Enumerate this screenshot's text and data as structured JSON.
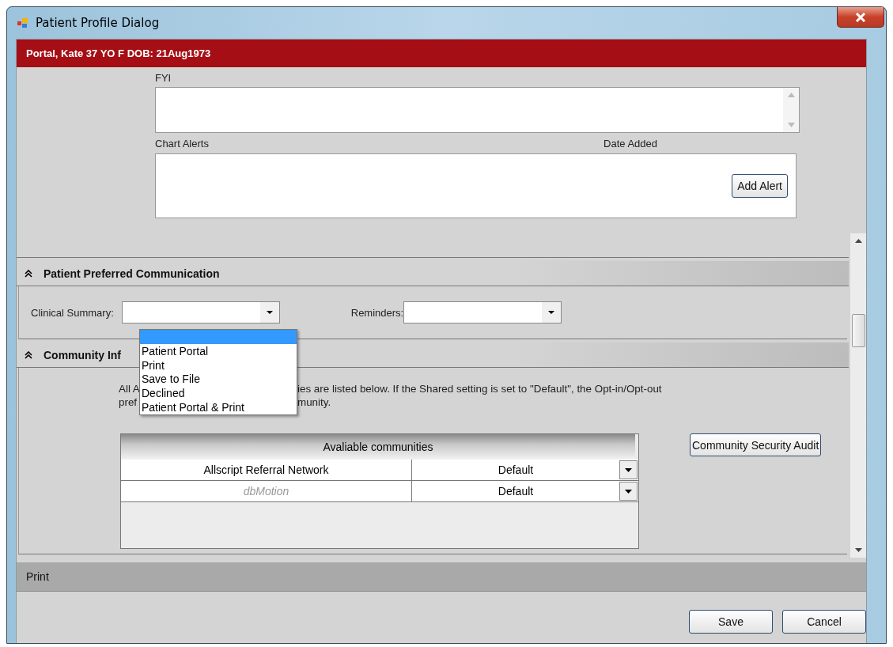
{
  "window": {
    "title": "Patient Profile Dialog"
  },
  "patient_banner": "Portal, Kate  37 YO  F DOB: 21Aug1973",
  "fyi": {
    "label": "FYI"
  },
  "chart_alerts": {
    "label": "Chart Alerts",
    "date_column": "Date Added",
    "add_button": "Add Alert"
  },
  "preferred_communication": {
    "title": "Patient Preferred Communication",
    "expanded": true,
    "clinical_summary": {
      "label": "Clinical Summary:",
      "open": true,
      "options": [
        {
          "selected": true
        },
        {
          "label": "Patient Portal",
          "selected": false
        },
        {
          "label": "Print",
          "selected": false
        },
        {
          "label": "Save to File",
          "selected": false
        },
        {
          "label": "Declined",
          "selected": false
        },
        {
          "label": "Patient Portal & Print",
          "selected": false
        }
      ]
    },
    "reminders": {
      "label": "Reminders:"
    }
  },
  "community": {
    "title": "Community Inf",
    "expanded": true,
    "note_line_1": [
      "All A",
      "ies are listed below. If the Shared setting is set to \"Default\", the Opt-in/Opt-out"
    ],
    "note_line_2": [
      "pref",
      "munity."
    ],
    "table": {
      "header": "Avaliable communities",
      "rows": [
        {
          "name": "Allscript Referral Network",
          "shared": "Default",
          "disabled": false
        },
        {
          "name": "dbMotion",
          "shared": "Default",
          "disabled": true
        }
      ]
    },
    "audit_button": "Community Security Audit"
  },
  "print_section": {
    "title": "Print"
  },
  "buttons": [
    "Save",
    "Cancel"
  ]
}
